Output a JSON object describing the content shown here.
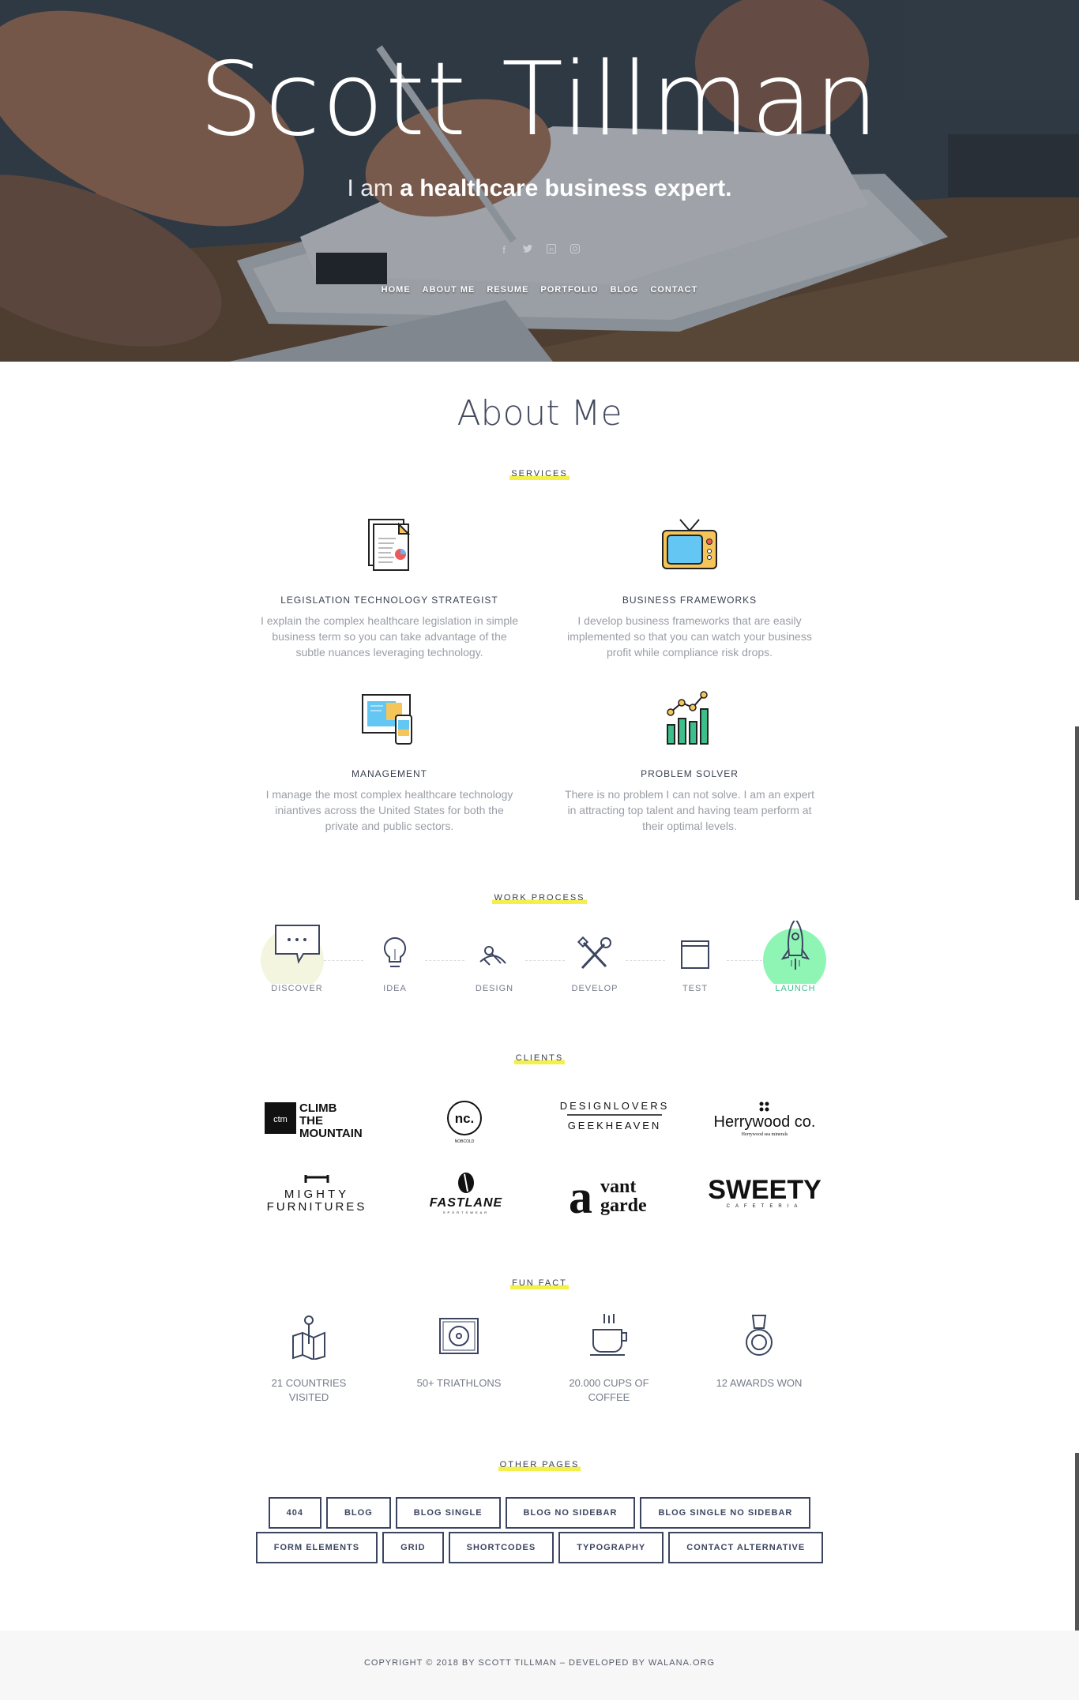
{
  "hero": {
    "title": "Scott Tillman",
    "subtitle_prefix": "I am",
    "subtitle_bold": "a healthcare business expert.",
    "socials": [
      {
        "icon": "facebook-icon",
        "glyph": "f"
      },
      {
        "icon": "twitter-icon",
        "glyph": "🐦"
      },
      {
        "icon": "linkedin-icon",
        "glyph": "in"
      },
      {
        "icon": "instagram-icon",
        "glyph": "◎"
      }
    ],
    "nav": [
      "HOME",
      "ABOUT ME",
      "RESUME",
      "PORTFOLIO",
      "BLOG",
      "CONTACT"
    ]
  },
  "about": {
    "title": "About Me",
    "services_label": "SERVICES",
    "services": [
      {
        "icon": "documents-icon",
        "title": "LEGISLATION TECHNOLOGY STRATEGIST",
        "text": "I explain the complex healthcare legislation in simple business term so you can take advantage of the subtle nuances leveraging technology."
      },
      {
        "icon": "tv-icon",
        "title": "BUSINESS FRAMEWORKS",
        "text": "I develop business frameworks that are easily implemented so that you can watch your business profit while compliance risk drops."
      },
      {
        "icon": "devices-icon",
        "title": "MANAGEMENT",
        "text": "I manage the most complex healthcare technology iniantives across the United States for both the private and public sectors."
      },
      {
        "icon": "bar-chart-icon",
        "title": "PROBLEM SOLVER",
        "text": "There is no problem I can not solve. I am an expert in attracting top talent and having team perform at their optimal levels."
      }
    ],
    "process_label": "WORK PROCESS",
    "process": [
      {
        "icon": "chat-bubble-icon",
        "label": "DISCOVER"
      },
      {
        "icon": "lightbulb-icon",
        "label": "IDEA"
      },
      {
        "icon": "pen-tool-icon",
        "label": "DESIGN"
      },
      {
        "icon": "tools-icon",
        "label": "DEVELOP"
      },
      {
        "icon": "browser-window-icon",
        "label": "TEST"
      },
      {
        "icon": "rocket-icon",
        "label": "LAUNCH"
      }
    ],
    "clients_label": "CLIENTS",
    "clients": {
      "climb": {
        "badge": "ctm",
        "line1": "CLIMB",
        "line2": "THE",
        "line3": "MOUNTAIN"
      },
      "nocold": {
        "mark": "nc.",
        "name": "NOBCOLD"
      },
      "designlovers": {
        "top": "DESIGNLOVERS",
        "bottom": "GEEKHEAVEN"
      },
      "herrywood": {
        "name": "Herrywood co.",
        "tagline": "Herrywood sea minerals"
      },
      "mighty": {
        "line1": "MIGHTY",
        "line2": "FURNITURES"
      },
      "fastlane": {
        "name": "FASTLANE",
        "tagline": "SPORTSWEAR"
      },
      "avantgarde": {
        "a": "a",
        "line1": "vant",
        "line2": "garde"
      },
      "sweety": {
        "name": "SWEETY",
        "tagline": "CAFETERIA"
      }
    },
    "facts_label": "FUN FACT",
    "facts": [
      {
        "icon": "map-pin-icon",
        "label": "21 COUNTRIES VISITED"
      },
      {
        "icon": "disc-player-icon",
        "label": "50+ TRIATHLONS"
      },
      {
        "icon": "coffee-cup-icon",
        "label": "20.000 CUPS OF COFFEE"
      },
      {
        "icon": "medal-icon",
        "label": "12 AWARDS WON"
      }
    ],
    "pages_label": "OTHER PAGES",
    "pages_row1": [
      "404",
      "BLOG",
      "BLOG SINGLE",
      "BLOG NO SIDEBAR",
      "BLOG SINGLE NO SIDEBAR"
    ],
    "pages_row2": [
      "FORM ELEMENTS",
      "GRID",
      "SHORTCODES",
      "TYPOGRAPHY",
      "CONTACT ALTERNATIVE"
    ]
  },
  "footer": {
    "text": "COPYRIGHT © 2018 BY SCOTT TILLMAN – DEVELOPED BY WALANA.ORG"
  },
  "colors": {
    "accent_yellow": "#f3ef4b",
    "navy": "#3c4560",
    "launch_green": "#8ff5b5",
    "discover_bg": "#f4f5df"
  }
}
